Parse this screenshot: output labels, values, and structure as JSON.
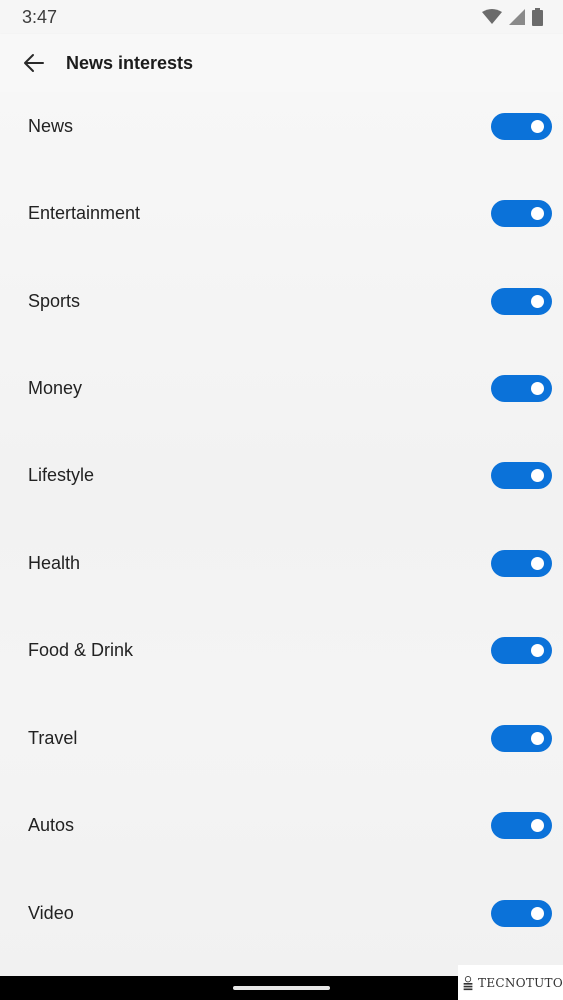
{
  "status_bar": {
    "time": "3:47",
    "icons": [
      "wifi-icon",
      "cellular-signal-icon",
      "battery-icon"
    ]
  },
  "header": {
    "back_icon": "arrow-left-icon",
    "title": "News interests"
  },
  "interests": [
    {
      "label": "News",
      "enabled": true
    },
    {
      "label": "Entertainment",
      "enabled": true
    },
    {
      "label": "Sports",
      "enabled": true
    },
    {
      "label": "Money",
      "enabled": true
    },
    {
      "label": "Lifestyle",
      "enabled": true
    },
    {
      "label": "Health",
      "enabled": true
    },
    {
      "label": "Food & Drink",
      "enabled": true
    },
    {
      "label": "Travel",
      "enabled": true
    },
    {
      "label": "Autos",
      "enabled": true
    },
    {
      "label": "Video",
      "enabled": true
    }
  ],
  "colors": {
    "toggle_on": "#0b72d9",
    "background": "#f6f6f6",
    "text": "#222222"
  },
  "watermark": {
    "text": "TECNOTUTO"
  }
}
